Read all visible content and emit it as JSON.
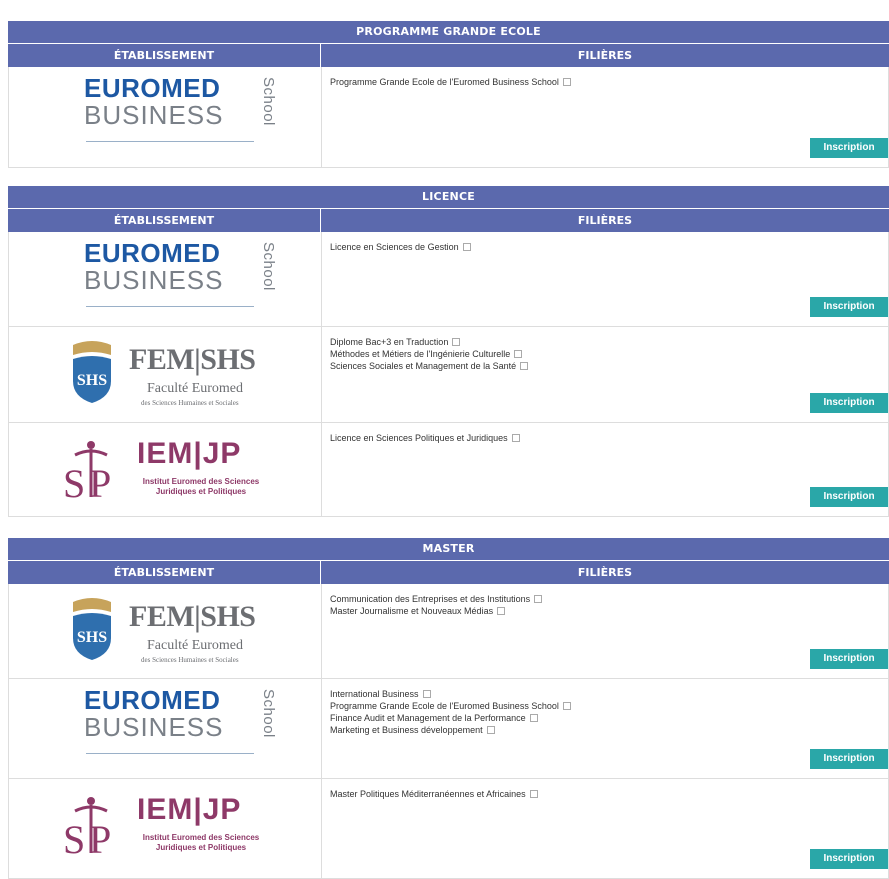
{
  "colors": {
    "header_bg": "#5b69ad",
    "button_bg": "#2aa7a8",
    "euromed_blue": "#1d58a3",
    "iem_purple": "#8e3968"
  },
  "col_labels": {
    "etablissement": "ÉTABLISSEMENT",
    "filieres": "FILIÈRES"
  },
  "button_label": "Inscription",
  "logos": {
    "euromed": {
      "line1": "EUROMED",
      "line2": "BUSINESS",
      "school": "School"
    },
    "femshs": {
      "line1": "FEM|SHS",
      "line2": "Faculté Euromed",
      "line3": "des Sciences Humaines et Sociales"
    },
    "iemjp": {
      "line1": "IEM|JP",
      "line2": "Institut Euromed des Sciences Juridiques et Politiques"
    }
  },
  "sections": {
    "pge": {
      "title": "PROGRAMME GRANDE ECOLE",
      "rows": [
        {
          "logo": "euromed",
          "filieres": [
            "Programme Grande Ecole de l'Euromed Business School"
          ]
        }
      ]
    },
    "licence": {
      "title": "LICENCE",
      "rows": [
        {
          "logo": "euromed",
          "filieres": [
            "Licence en Sciences de Gestion"
          ]
        },
        {
          "logo": "femshs",
          "filieres": [
            "Diplome Bac+3 en Traduction",
            "Méthodes et Métiers de l'Ingénierie Culturelle",
            "Sciences Sociales et Management de la Santé"
          ]
        },
        {
          "logo": "iemjp",
          "filieres": [
            "Licence en Sciences Politiques et Juridiques"
          ]
        }
      ]
    },
    "master": {
      "title": "MASTER",
      "rows": [
        {
          "logo": "femshs",
          "filieres": [
            "Communication des Entreprises et des Institutions",
            "Master Journalisme et Nouveaux Médias"
          ]
        },
        {
          "logo": "euromed",
          "filieres": [
            "International Business",
            "Programme Grande Ecole de l'Euromed Business School",
            "Finance Audit et Management de la Performance",
            "Marketing et Business développement"
          ]
        },
        {
          "logo": "iemjp",
          "filieres": [
            "Master Politiques Méditerranéennes et Africaines"
          ]
        }
      ]
    }
  }
}
